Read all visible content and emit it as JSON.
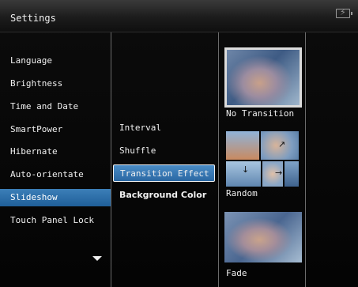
{
  "window": {
    "title": "Settings"
  },
  "menu": {
    "items": [
      {
        "label": "Language"
      },
      {
        "label": "Brightness"
      },
      {
        "label": "Time and Date"
      },
      {
        "label": "SmartPower"
      },
      {
        "label": "Hibernate"
      },
      {
        "label": "Auto-orientate"
      },
      {
        "label": "Slideshow",
        "selected": true
      },
      {
        "label": "Touch Panel Lock"
      }
    ]
  },
  "submenu": {
    "items": [
      {
        "label": "Interval"
      },
      {
        "label": "Shuffle"
      },
      {
        "label": "Transition Effect",
        "focused": true
      },
      {
        "label": "Background Color"
      }
    ]
  },
  "options": [
    {
      "label": "No Transition",
      "selected": true
    },
    {
      "label": "Random"
    },
    {
      "label": "Fade"
    }
  ],
  "colors": {
    "accent": "#2a67a3",
    "background": "#050505",
    "text": "#f0f0f0"
  },
  "icons": [
    "battery-icon",
    "scroll-down-arrow-icon"
  ]
}
